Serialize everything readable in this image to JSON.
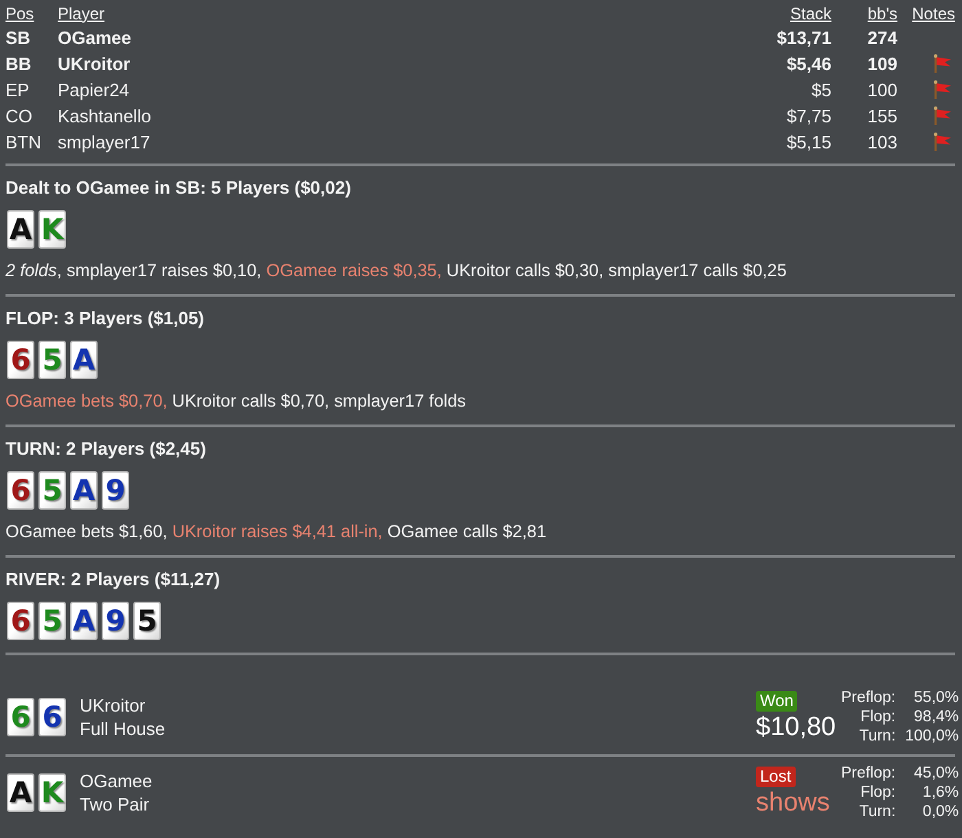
{
  "players_table": {
    "columns": [
      "Pos",
      "Player",
      "Stack",
      "bb's",
      "Notes"
    ],
    "rows": [
      {
        "pos": "SB",
        "player": "OGamee",
        "stack": "$13,71",
        "bbs": "274",
        "emphasized": true,
        "has_note": false
      },
      {
        "pos": "BB",
        "player": "UKroitor",
        "stack": "$5,46",
        "bbs": "109",
        "emphasized": true,
        "has_note": true
      },
      {
        "pos": "EP",
        "player": "Papier24",
        "stack": "$5",
        "bbs": "100",
        "emphasized": false,
        "has_note": true
      },
      {
        "pos": "CO",
        "player": "Kashtanello",
        "stack": "$7,75",
        "bbs": "155",
        "emphasized": false,
        "has_note": true
      },
      {
        "pos": "BTN",
        "player": "smplayer17",
        "stack": "$5,15",
        "bbs": "103",
        "emphasized": false,
        "has_note": true
      }
    ]
  },
  "streets": [
    {
      "title": "Dealt to OGamee in SB: 5 Players ($0,02)",
      "cards": [
        {
          "rank": "A",
          "color": "#111111"
        },
        {
          "rank": "K",
          "color": "#1e8a1e"
        }
      ],
      "actions": [
        {
          "kind": "folds",
          "text": "2 folds"
        },
        {
          "kind": "plain",
          "text": ", smplayer17 raises $0,10, "
        },
        {
          "kind": "hero",
          "text": "OGamee raises $0,35,"
        },
        {
          "kind": "plain",
          "text": " UKroitor calls $0,30, smplayer17 calls $0,25"
        }
      ]
    },
    {
      "title": "FLOP: 3 Players ($1,05)",
      "cards": [
        {
          "rank": "6",
          "color": "#a01818"
        },
        {
          "rank": "5",
          "color": "#1e8a1e"
        },
        {
          "rank": "A",
          "color": "#1434b0"
        }
      ],
      "actions": [
        {
          "kind": "hero",
          "text": "OGamee bets $0,70,"
        },
        {
          "kind": "plain",
          "text": " UKroitor calls $0,70, smplayer17 folds"
        }
      ]
    },
    {
      "title": "TURN: 2 Players ($2,45)",
      "cards": [
        {
          "rank": "6",
          "color": "#a01818"
        },
        {
          "rank": "5",
          "color": "#1e8a1e"
        },
        {
          "rank": "A",
          "color": "#1434b0"
        },
        {
          "rank": "9",
          "color": "#1434b0"
        }
      ],
      "actions": [
        {
          "kind": "plain",
          "text": "OGamee bets $1,60, "
        },
        {
          "kind": "hero",
          "text": "UKroitor raises $4,41 all-in,"
        },
        {
          "kind": "plain",
          "text": " OGamee calls $2,81"
        }
      ]
    },
    {
      "title": "RIVER: 2 Players ($11,27)",
      "cards": [
        {
          "rank": "6",
          "color": "#a01818"
        },
        {
          "rank": "5",
          "color": "#1e8a1e"
        },
        {
          "rank": "A",
          "color": "#1434b0"
        },
        {
          "rank": "9",
          "color": "#1434b0"
        },
        {
          "rank": "5",
          "color": "#111111"
        }
      ]
    }
  ],
  "showdown": [
    {
      "cards": [
        {
          "rank": "6",
          "color": "#1e8a1e"
        },
        {
          "rank": "6",
          "color": "#1434b0"
        }
      ],
      "player": "UKroitor",
      "hand": "Full House",
      "result": {
        "kind": "won",
        "label": "Won"
      },
      "outcome": "$10,80",
      "equity": [
        {
          "street": "Preflop:",
          "value": "55,0%"
        },
        {
          "street": "Flop:",
          "value": "98,4%"
        },
        {
          "street": "Turn:",
          "value": "100,0%"
        }
      ]
    },
    {
      "cards": [
        {
          "rank": "A",
          "color": "#111111"
        },
        {
          "rank": "K",
          "color": "#1e8a1e"
        }
      ],
      "player": "OGamee",
      "hand": "Two Pair",
      "result": {
        "kind": "lost",
        "label": "Lost"
      },
      "outcome": "shows",
      "equity": [
        {
          "street": "Preflop:",
          "value": "45,0%"
        },
        {
          "street": "Flop:",
          "value": "1,6%"
        },
        {
          "street": "Turn:",
          "value": "0,0%"
        }
      ]
    }
  ]
}
